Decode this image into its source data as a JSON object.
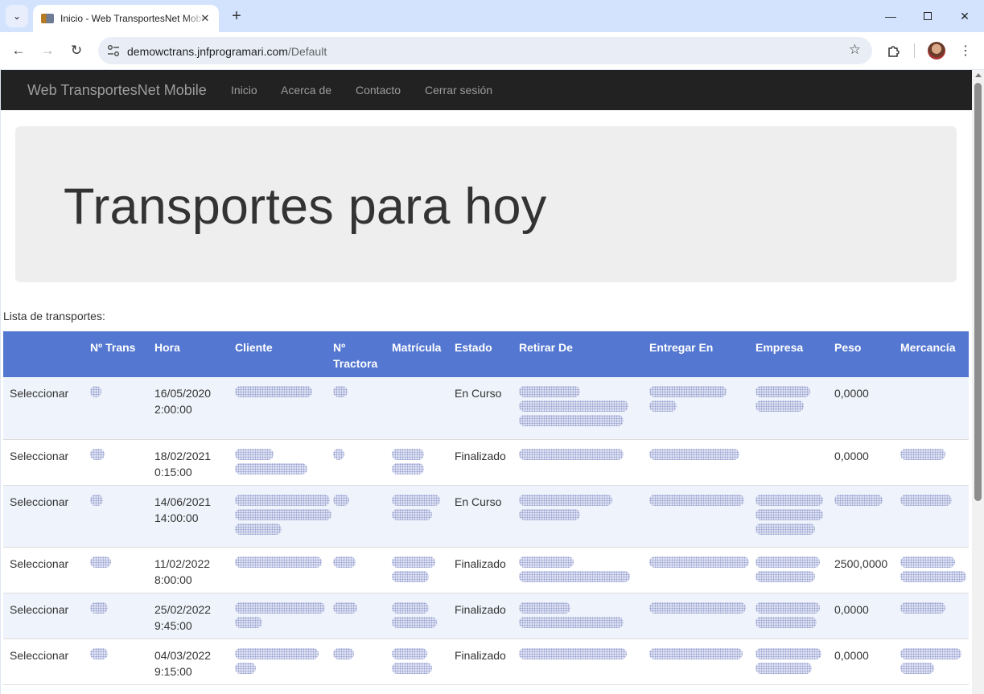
{
  "browser": {
    "tab_title": "Inicio - Web TransportesNet Mobile",
    "url_host": "demowctrans.jnfprogramari.com",
    "url_path": "/Default"
  },
  "site": {
    "brand": "Web TransportesNet Mobile",
    "nav": [
      "Inicio",
      "Acerca de",
      "Contacto",
      "Cerrar sesión"
    ]
  },
  "jumbotron": {
    "title": "Transportes para hoy"
  },
  "list_label": "Lista de transportes:",
  "table": {
    "headers": [
      "",
      "Nº Trans",
      "Hora",
      "Cliente",
      "Nº Tractora",
      "Matrícula",
      "Estado",
      "Retirar De",
      "Entregar En",
      "Empresa",
      "Peso",
      "Mercancía"
    ],
    "select_label": "Seleccionar",
    "rows": [
      {
        "date": "16/05/2020",
        "time": "2:00:00",
        "estado": "En Curso",
        "peso": "0,0000",
        "blur": {
          "ntrans": [
            14
          ],
          "cliente": [
            96
          ],
          "tractora": [
            18
          ],
          "matricula": [],
          "retirar": [
            76,
            136,
            130
          ],
          "entregar": [
            96,
            34
          ],
          "empresa": [
            68,
            60
          ],
          "peso": [],
          "mercancia": []
        }
      },
      {
        "date": "18/02/2021",
        "time": "0:15:00",
        "estado": "Finalizado",
        "peso": "0,0000",
        "blur": {
          "ntrans": [
            18
          ],
          "cliente": [
            48,
            90
          ],
          "tractora": [
            14
          ],
          "matricula": [
            40,
            40
          ],
          "retirar": [
            130
          ],
          "entregar": [
            112
          ],
          "empresa": [],
          "peso": [],
          "mercancia": [
            56
          ]
        }
      },
      {
        "date": "14/06/2021",
        "time": "14:00:00",
        "estado": "En Curso",
        "peso": "",
        "blur": {
          "ntrans": [
            16
          ],
          "cliente": [
            118,
            120,
            58
          ],
          "tractora": [
            20
          ],
          "matricula": [
            60,
            50
          ],
          "retirar": [
            116,
            76
          ],
          "entregar": [
            118
          ],
          "empresa": [
            84,
            84,
            74
          ],
          "peso": [
            60
          ],
          "mercancia": [
            64
          ]
        }
      },
      {
        "date": "11/02/2022",
        "time": "8:00:00",
        "estado": "Finalizado",
        "peso": "2500,0000",
        "blur": {
          "ntrans": [
            26
          ],
          "cliente": [
            108
          ],
          "tractora": [
            28
          ],
          "matricula": [
            54,
            46
          ],
          "retirar": [
            68,
            138
          ],
          "entregar": [
            124
          ],
          "empresa": [
            80,
            74
          ],
          "peso": [],
          "mercancia": [
            68,
            82
          ]
        }
      },
      {
        "date": "25/02/2022",
        "time": "9:45:00",
        "estado": "Finalizado",
        "peso": "0,0000",
        "blur": {
          "ntrans": [
            22
          ],
          "cliente": [
            112,
            34
          ],
          "tractora": [
            30
          ],
          "matricula": [
            46,
            56
          ],
          "retirar": [
            64,
            130
          ],
          "entregar": [
            120
          ],
          "empresa": [
            80,
            76
          ],
          "peso": [],
          "mercancia": [
            56
          ]
        }
      },
      {
        "date": "04/03/2022",
        "time": "9:15:00",
        "estado": "Finalizado",
        "peso": "0,0000",
        "blur": {
          "ntrans": [
            22
          ],
          "cliente": [
            104,
            26
          ],
          "tractora": [
            26
          ],
          "matricula": [
            44,
            50
          ],
          "retirar": [
            134
          ],
          "entregar": [
            116
          ],
          "empresa": [
            82,
            70
          ],
          "peso": [],
          "mercancia": [
            76,
            42
          ]
        }
      }
    ]
  }
}
